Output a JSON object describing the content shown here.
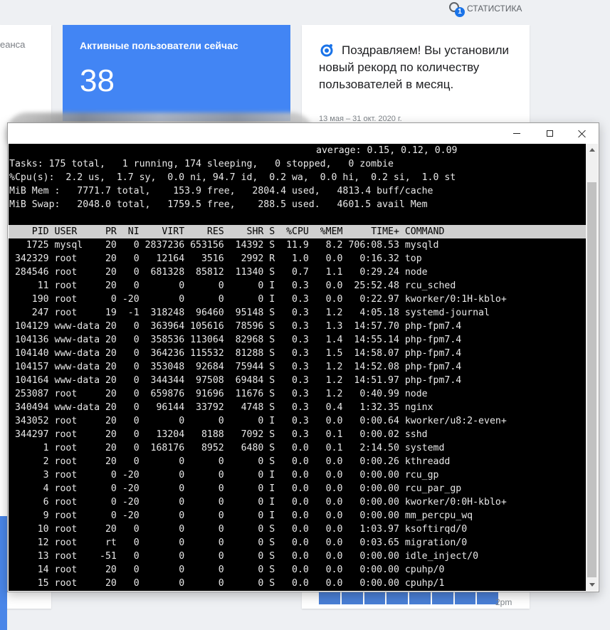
{
  "header": {
    "stats_label": "СТАТИСТИКА",
    "badge": "1"
  },
  "cards": {
    "left_label": "еанса",
    "active_title": "Активные пользователи сейчас",
    "active_value": "38",
    "insight_text": "Поздравляем! Вы установили новый рекорд по количеству пользователей в месяц.",
    "insight_dates": "13 мая – 31 окт. 2020 г.",
    "time_label": "2pm"
  },
  "colors": {
    "accent": "#4285f4",
    "terminal_bg": "#000000",
    "terminal_fg": "#e8e8e8",
    "header_bar": "#d0d0d0"
  },
  "terminal": {
    "summary": [
      "average: 0.15, 0.12, 0.09",
      "Tasks: 175 total,   1 running, 174 sleeping,   0 stopped,   0 zombie",
      "%Cpu(s):  2.2 us,  1.7 sy,  0.0 ni, 94.7 id,  0.2 wa,  0.0 hi,  0.2 si,  1.0 st",
      "MiB Mem :   7771.7 total,    153.9 free,   2804.4 used,   4813.4 buff/cache",
      "MiB Swap:   2048.0 total,   1759.5 free,    288.5 used.   4601.5 avail Mem"
    ],
    "columns": [
      "PID",
      "USER",
      "PR",
      "NI",
      "VIRT",
      "RES",
      "SHR",
      "S",
      "%CPU",
      "%MEM",
      "TIME+",
      "COMMAND"
    ],
    "processes": [
      [
        "1725",
        "mysql",
        "20",
        "0",
        "2837236",
        "653156",
        "14392",
        "S",
        "11.9",
        "8.2",
        "706:08.53",
        "mysqld"
      ],
      [
        "342329",
        "root",
        "20",
        "0",
        "12164",
        "3516",
        "2992",
        "R",
        "1.0",
        "0.0",
        "0:16.32",
        "top"
      ],
      [
        "284546",
        "root",
        "20",
        "0",
        "681328",
        "85812",
        "11340",
        "S",
        "0.7",
        "1.1",
        "0:29.24",
        "node"
      ],
      [
        "11",
        "root",
        "20",
        "0",
        "0",
        "0",
        "0",
        "I",
        "0.3",
        "0.0",
        "25:52.48",
        "rcu_sched"
      ],
      [
        "190",
        "root",
        "0",
        "-20",
        "0",
        "0",
        "0",
        "I",
        "0.3",
        "0.0",
        "0:22.97",
        "kworker/0:1H-kblo+"
      ],
      [
        "247",
        "root",
        "19",
        "-1",
        "318248",
        "96460",
        "95148",
        "S",
        "0.3",
        "1.2",
        "4:05.18",
        "systemd-journal"
      ],
      [
        "104129",
        "www-data",
        "20",
        "0",
        "363964",
        "105616",
        "78596",
        "S",
        "0.3",
        "1.3",
        "14:57.70",
        "php-fpm7.4"
      ],
      [
        "104136",
        "www-data",
        "20",
        "0",
        "358536",
        "113064",
        "82968",
        "S",
        "0.3",
        "1.4",
        "14:55.14",
        "php-fpm7.4"
      ],
      [
        "104140",
        "www-data",
        "20",
        "0",
        "364236",
        "115532",
        "81288",
        "S",
        "0.3",
        "1.5",
        "14:58.07",
        "php-fpm7.4"
      ],
      [
        "104157",
        "www-data",
        "20",
        "0",
        "353048",
        "92684",
        "75944",
        "S",
        "0.3",
        "1.2",
        "14:52.08",
        "php-fpm7.4"
      ],
      [
        "104164",
        "www-data",
        "20",
        "0",
        "344344",
        "97508",
        "69484",
        "S",
        "0.3",
        "1.2",
        "14:51.97",
        "php-fpm7.4"
      ],
      [
        "253087",
        "root",
        "20",
        "0",
        "659876",
        "91696",
        "11676",
        "S",
        "0.3",
        "1.2",
        "0:40.99",
        "node"
      ],
      [
        "340494",
        "www-data",
        "20",
        "0",
        "96144",
        "33792",
        "4748",
        "S",
        "0.3",
        "0.4",
        "1:32.35",
        "nginx"
      ],
      [
        "343052",
        "root",
        "20",
        "0",
        "0",
        "0",
        "0",
        "I",
        "0.3",
        "0.0",
        "0:00.64",
        "kworker/u8:2-even+"
      ],
      [
        "344297",
        "root",
        "20",
        "0",
        "13204",
        "8188",
        "7092",
        "S",
        "0.3",
        "0.1",
        "0:00.02",
        "sshd"
      ],
      [
        "1",
        "root",
        "20",
        "0",
        "168176",
        "8952",
        "6480",
        "S",
        "0.0",
        "0.1",
        "2:14.50",
        "systemd"
      ],
      [
        "2",
        "root",
        "20",
        "0",
        "0",
        "0",
        "0",
        "S",
        "0.0",
        "0.0",
        "0:00.26",
        "kthreadd"
      ],
      [
        "3",
        "root",
        "0",
        "-20",
        "0",
        "0",
        "0",
        "I",
        "0.0",
        "0.0",
        "0:00.00",
        "rcu_gp"
      ],
      [
        "4",
        "root",
        "0",
        "-20",
        "0",
        "0",
        "0",
        "I",
        "0.0",
        "0.0",
        "0:00.00",
        "rcu_par_gp"
      ],
      [
        "6",
        "root",
        "0",
        "-20",
        "0",
        "0",
        "0",
        "I",
        "0.0",
        "0.0",
        "0:00.00",
        "kworker/0:0H-kblo+"
      ],
      [
        "9",
        "root",
        "0",
        "-20",
        "0",
        "0",
        "0",
        "I",
        "0.0",
        "0.0",
        "0:00.00",
        "mm_percpu_wq"
      ],
      [
        "10",
        "root",
        "20",
        "0",
        "0",
        "0",
        "0",
        "S",
        "0.0",
        "0.0",
        "1:03.97",
        "ksoftirqd/0"
      ],
      [
        "12",
        "root",
        "rt",
        "0",
        "0",
        "0",
        "0",
        "S",
        "0.0",
        "0.0",
        "0:03.65",
        "migration/0"
      ],
      [
        "13",
        "root",
        "-51",
        "0",
        "0",
        "0",
        "0",
        "S",
        "0.0",
        "0.0",
        "0:00.00",
        "idle_inject/0"
      ],
      [
        "14",
        "root",
        "20",
        "0",
        "0",
        "0",
        "0",
        "S",
        "0.0",
        "0.0",
        "0:00.00",
        "cpuhp/0"
      ],
      [
        "15",
        "root",
        "20",
        "0",
        "0",
        "0",
        "0",
        "S",
        "0.0",
        "0.0",
        "0:00.00",
        "cpuhp/1"
      ]
    ]
  }
}
